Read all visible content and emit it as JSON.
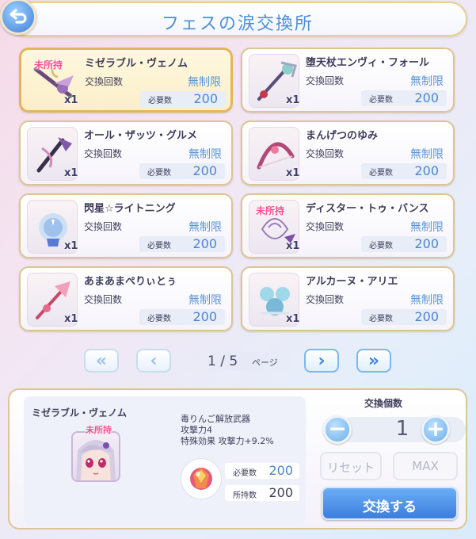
{
  "header": {
    "title": "フェスの涙交換所"
  },
  "items": [
    {
      "name": "ミゼラブル・ヴェノム",
      "count_label": "交換回数",
      "count_value": "無制限",
      "req_label": "必要数",
      "req_value": "200",
      "qty": "x1",
      "unowned": "未所持",
      "selected": true
    },
    {
      "name": "堕天杖エンヴィ・フォール",
      "count_label": "交換回数",
      "count_value": "無制限",
      "req_label": "必要数",
      "req_value": "200",
      "qty": "x1",
      "unowned": "",
      "selected": false
    },
    {
      "name": "オール・ザッツ・グルメ",
      "count_label": "交換回数",
      "count_value": "無制限",
      "req_label": "必要数",
      "req_value": "200",
      "qty": "x1",
      "unowned": "",
      "selected": false
    },
    {
      "name": "まんげつのゆみ",
      "count_label": "交換回数",
      "count_value": "無制限",
      "req_label": "必要数",
      "req_value": "200",
      "qty": "x1",
      "unowned": "",
      "selected": false
    },
    {
      "name": "閃星☆ライトニング",
      "count_label": "交換回数",
      "count_value": "無制限",
      "req_label": "必要数",
      "req_value": "200",
      "qty": "x1",
      "unowned": "",
      "selected": false
    },
    {
      "name": "ディスター・トゥ・バンス",
      "count_label": "交換回数",
      "count_value": "無制限",
      "req_label": "必要数",
      "req_value": "200",
      "qty": "x1",
      "unowned": "未所持",
      "selected": false
    },
    {
      "name": "あまあまぺりぃとぅ",
      "count_label": "交換回数",
      "count_value": "無制限",
      "req_label": "必要数",
      "req_value": "200",
      "qty": "x1",
      "unowned": "",
      "selected": false
    },
    {
      "name": "アルカーヌ・アリエ",
      "count_label": "交換回数",
      "count_value": "無制限",
      "req_label": "必要数",
      "req_value": "200",
      "qty": "x1",
      "unowned": "",
      "selected": false
    }
  ],
  "pager": {
    "current": "1 / 5",
    "suffix": "ページ",
    "first": "«",
    "prev": "‹",
    "next": "›",
    "last": "»"
  },
  "detail": {
    "name": "ミゼラブル・ヴェノム",
    "unowned": "未所持",
    "desc1": "毒りんご解放武器",
    "desc2": "攻撃力4",
    "desc3": "特殊効果 攻撃力+9.2%",
    "req_label": "必要数",
    "req_value": "200",
    "own_label": "所持数",
    "own_value": "200"
  },
  "exchange": {
    "count_label": "交換個数",
    "quantity": "1",
    "minus": "−",
    "plus": "+",
    "reset": "リセット",
    "max": "MAX",
    "submit": "交換する"
  },
  "colors": {
    "accent": "#4b86d2",
    "unowned": "#ff4f8f",
    "gold_border": "#dcc595"
  }
}
